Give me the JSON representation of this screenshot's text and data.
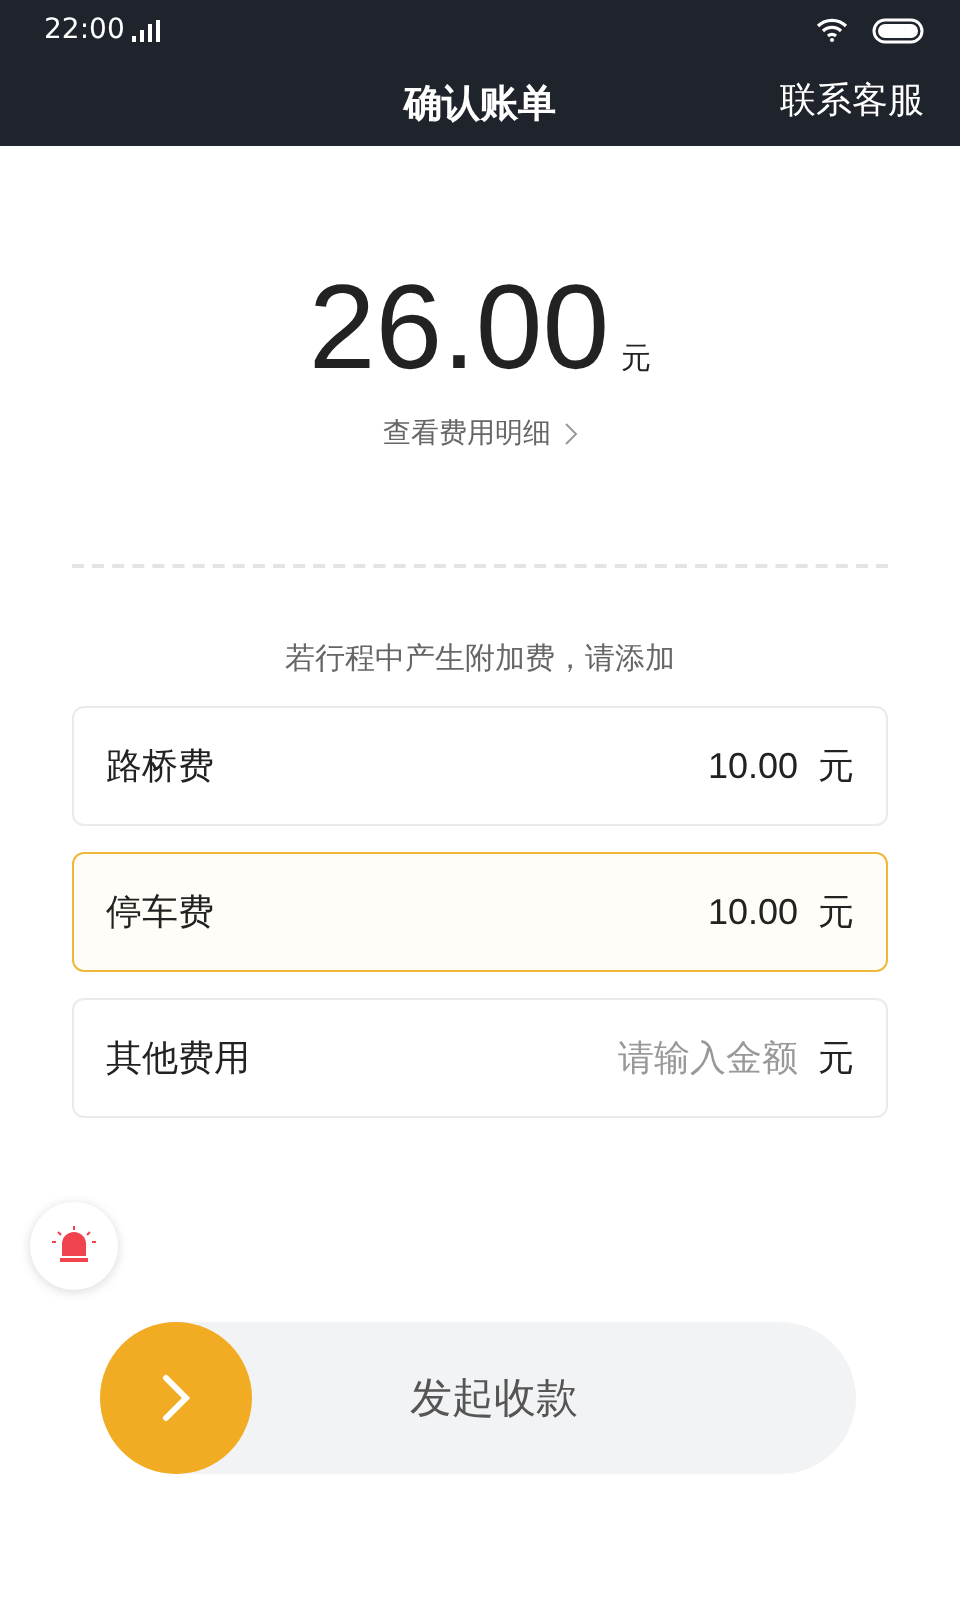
{
  "status_bar": {
    "time": "22:00"
  },
  "nav": {
    "title": "确认账单",
    "action": "联系客服"
  },
  "amount": {
    "value": "26.00",
    "unit": "元",
    "detail_link": "查看费用明细"
  },
  "hint": "若行程中产生附加费，请添加",
  "fees": [
    {
      "label": "路桥费",
      "value": "10.00",
      "unit": "元",
      "focused": false
    },
    {
      "label": "停车费",
      "value": "10.00",
      "unit": "元",
      "focused": true
    },
    {
      "label": "其他费用",
      "placeholder": "请输入金额",
      "unit": "元",
      "focused": false
    }
  ],
  "slider": {
    "label": "发起收款",
    "level": 0
  }
}
